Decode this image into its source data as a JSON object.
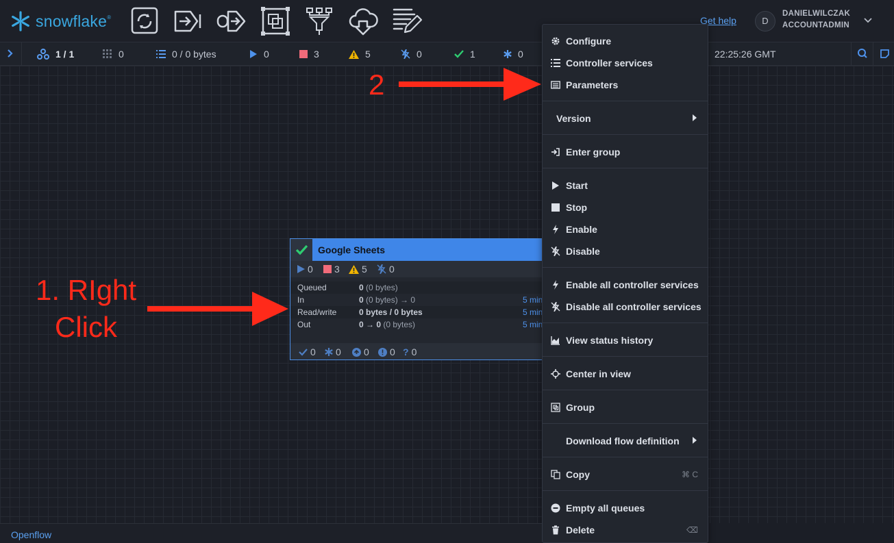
{
  "header": {
    "logo_text": "snowflake",
    "toolbar_icons": [
      "processor-icon",
      "input-port-icon",
      "output-port-icon",
      "process-group-icon",
      "remote-process-group-icon",
      "funnel-icon",
      "label-icon"
    ],
    "help_link": "Get help",
    "user_initial": "D",
    "user_name": "DANIELWILCZAK",
    "user_role": "ACCOUNTADMIN"
  },
  "status_bar": {
    "cluster": "1 / 1",
    "threads": "0",
    "queued": "0 / 0 bytes",
    "running": "0",
    "stopped": "3",
    "invalid": "5",
    "disabled": "0",
    "up_to_date": "1",
    "locally_modified": "0",
    "time": "22:25:26 GMT"
  },
  "process_group": {
    "title": "Google Sheets",
    "counts": {
      "running": "0",
      "stopped": "3",
      "invalid": "5",
      "disabled": "0"
    },
    "stats": [
      {
        "label": "Queued",
        "value": "0",
        "detail": "(0 bytes)",
        "window": ""
      },
      {
        "label": "In",
        "value": "0",
        "detail": "(0 bytes) → 0",
        "window": "5 min"
      },
      {
        "label": "Read/write",
        "value": "0 bytes / 0 bytes",
        "detail": "",
        "window": "5 min"
      },
      {
        "label": "Out",
        "value": "0 → 0",
        "detail": "(0 bytes)",
        "window": "5 min"
      }
    ],
    "footer": {
      "up_to_date": "0",
      "locally_modified": "0",
      "stale": "0",
      "sync_failure": "0",
      "unknown": "0"
    }
  },
  "context_menu": {
    "items": [
      {
        "label": "Configure",
        "icon": "gear-icon"
      },
      {
        "label": "Controller services",
        "icon": "list-icon"
      },
      {
        "label": "Parameters",
        "icon": "parameters-icon"
      },
      {
        "label": "Version",
        "icon": ""
      },
      {
        "label": "Enter group",
        "icon": "enter-icon"
      },
      {
        "label": "Start",
        "icon": "play-icon"
      },
      {
        "label": "Stop",
        "icon": "stop-icon"
      },
      {
        "label": "Enable",
        "icon": "bolt-icon"
      },
      {
        "label": "Disable",
        "icon": "disabled-icon"
      },
      {
        "label": "Enable all controller services",
        "icon": "bolt-icon"
      },
      {
        "label": "Disable all controller services",
        "icon": "disabled-icon"
      },
      {
        "label": "View status history",
        "icon": "area-chart-icon"
      },
      {
        "label": "Center in view",
        "icon": "crosshairs-icon"
      },
      {
        "label": "Group",
        "icon": "group-icon"
      },
      {
        "label": "Download flow definition",
        "icon": ""
      },
      {
        "label": "Copy",
        "icon": "copy-icon",
        "shortcut": "⌘ C"
      },
      {
        "label": "Empty all queues",
        "icon": "minus-circle-icon"
      },
      {
        "label": "Delete",
        "icon": "trash-icon",
        "shortcut": "⌫"
      }
    ]
  },
  "breadcrumb": "Openflow",
  "annotations": {
    "step2": "2",
    "step1_line1": "1. RIght",
    "step1_line2": "Click"
  },
  "colors": {
    "accent": "#3f86e8",
    "annotation": "#ff2a1a",
    "ok": "#2ecc71",
    "stop": "#e8505b",
    "warn": "#f0b400"
  }
}
